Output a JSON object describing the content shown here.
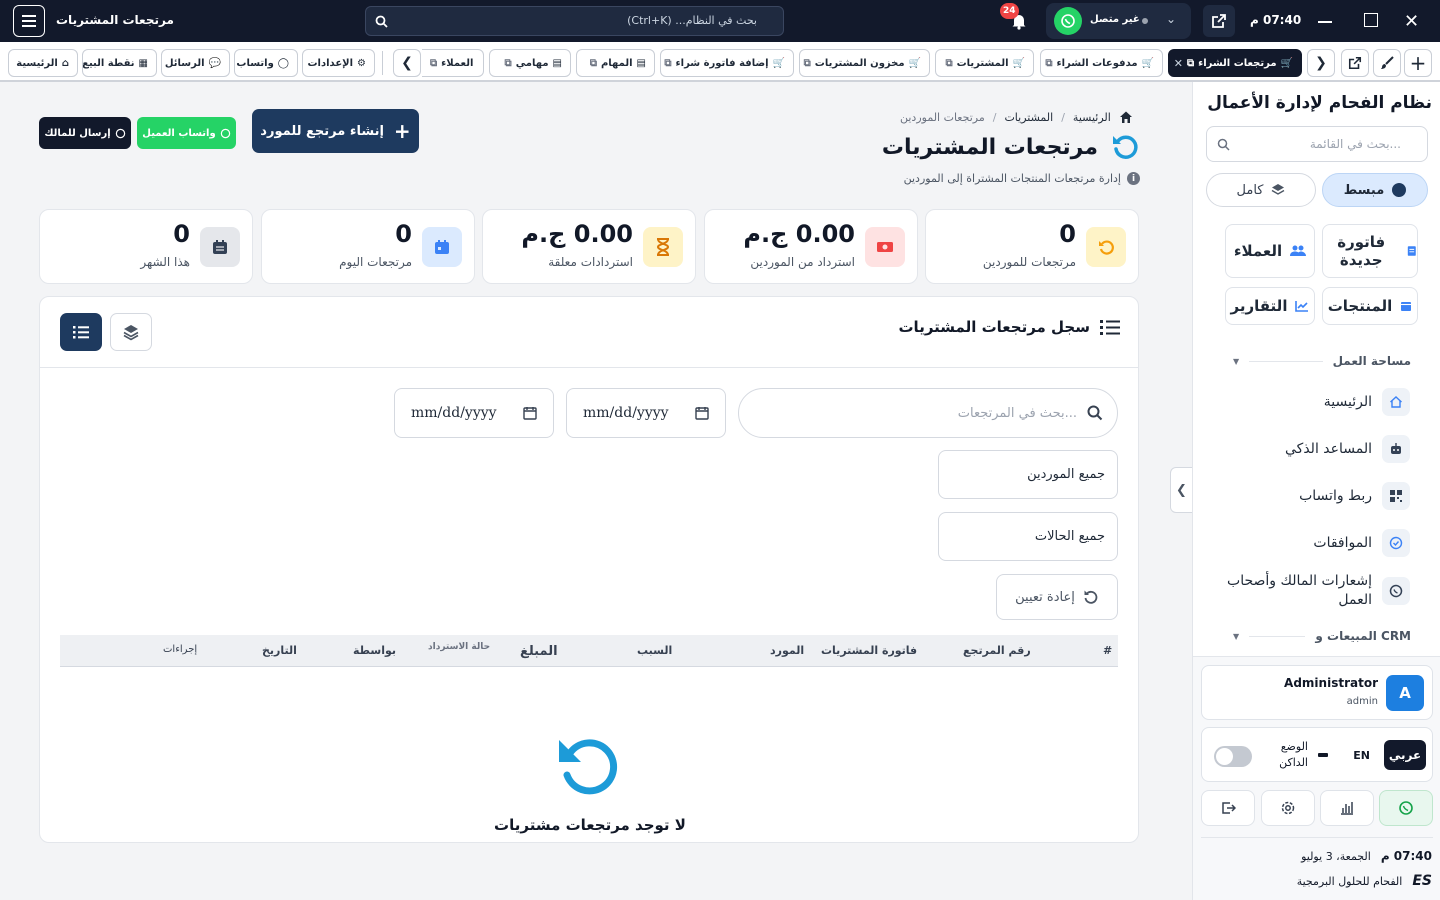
{
  "window": {
    "time": "07:40 م",
    "status_text": "غير متصل",
    "search_placeholder": "بحث في النظام... (Ctrl+K)",
    "notif_count": "24",
    "app_title": "مرتجعات المشتريات"
  },
  "tabs": [
    {
      "label": "مرتجعات الشراء",
      "active": true
    },
    {
      "label": "مدفوعات الشراء"
    },
    {
      "label": "المشتريات"
    },
    {
      "label": "مخزون المشتريات"
    },
    {
      "label": "إضافة فاتورة شراء"
    },
    {
      "label": "المهام"
    },
    {
      "label": "مهامي"
    },
    {
      "label": "العملاء"
    }
  ],
  "quick": {
    "settings": "الإعدادات",
    "whatsapp": "واتساب",
    "messages": "الرسائل",
    "pos": "نقطة البيع",
    "home": "الرئيسية"
  },
  "breadcrumb": {
    "home": "الرئيسية",
    "sep": "/",
    "purchases": "المشتريات",
    "current": "مرتجعات الموردين"
  },
  "page": {
    "title": "مرتجعات المشتريات",
    "subtitle": "إدارة مرتجعات المنتجات المشتراة إلى الموردين"
  },
  "actions": {
    "create": "إنشاء مرتجع للمورد",
    "whatsapp_client": "واتساب العميل",
    "send_owner": "إرسال للمالك"
  },
  "stats": [
    {
      "value": "0",
      "label": "مرتجعات للموردين",
      "color": "#f59e0b"
    },
    {
      "value": "0.00 ج.م",
      "label": "استرداد من الموردين",
      "color": "#ef4444"
    },
    {
      "value": "0.00 ج.م",
      "label": "استردادات معلقة",
      "color": "#d97706"
    },
    {
      "value": "0",
      "label": "مرتجعات اليوم",
      "color": "#3b82f6"
    },
    {
      "value": "0",
      "label": "هذا الشهر",
      "color": "#334155"
    }
  ],
  "panel": {
    "title": "سجل مرتجعات المشتريات"
  },
  "filters": {
    "search_placeholder": "بحث في المرتجعات...",
    "date1": "mm/dd/yyyy",
    "date2": "mm/dd/yyyy",
    "suppliers": "جميع الموردين",
    "statuses": "جميع الحالات",
    "reset": "إعادة تعيين"
  },
  "table": {
    "headers": [
      "#",
      "رقم المرتجع",
      "فاتورة المشتريات",
      "المورد",
      "السبب",
      "المبلغ",
      "حالة الاسترداد",
      "بواسطة",
      "التاريخ",
      "إجراءات"
    ]
  },
  "empty": {
    "text": "لا توجد مرتجعات مشتريات"
  },
  "sidebar": {
    "title": "نظام الفحام لإدارة الأعمال",
    "search_placeholder": "بحث في القائمة...",
    "mode_simple": "مبسط",
    "mode_full": "كامل",
    "quick_actions": {
      "new_invoice": "فاتورة جديدة",
      "customers": "العملاء",
      "products": "المنتجات",
      "reports": "التقارير"
    },
    "section_workspace": "مساحة العمل",
    "items": [
      "الرئيسية",
      "المساعد الذكي",
      "ربط واتساب",
      "الموافقات",
      "إشعارات المالك وأصحاب العمل"
    ],
    "section_sales": "المبيعات و CRM",
    "user": {
      "name": "Administrator",
      "role": "admin",
      "initial": "A"
    },
    "lang_ar": "عربي",
    "lang_en": "EN",
    "dark_mode": "الوضع الداكن",
    "clock": "07:40 م",
    "date": "الجمعة، 3 يوليو",
    "company": "الفحام للحلول البرمجية"
  },
  "colors": {
    "primary": "#1e3a5f",
    "navy": "#12192b",
    "green": "#25d366",
    "accent": "#1d9bd8"
  }
}
